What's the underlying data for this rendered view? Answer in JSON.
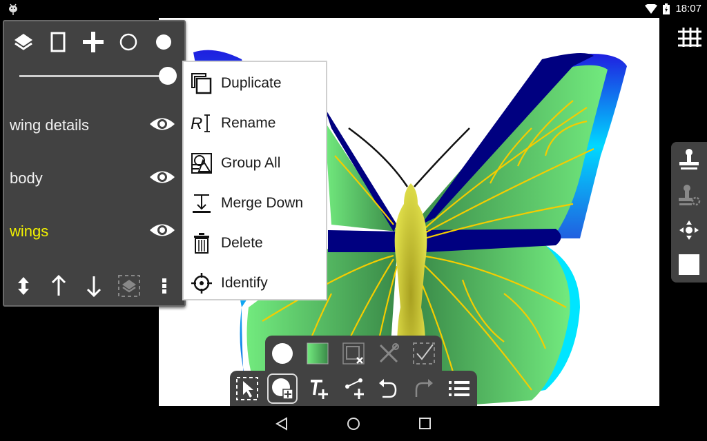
{
  "status_bar": {
    "time": "18:07",
    "icons": [
      "android-debug-icon",
      "wifi-icon",
      "battery-charging-icon"
    ]
  },
  "layers_panel": {
    "toolbar": [
      {
        "name": "layers-icon",
        "label": "Layers"
      },
      {
        "name": "page-icon",
        "label": "Page"
      },
      {
        "name": "add-layer-icon",
        "label": "Add"
      },
      {
        "name": "hollow-circle-icon",
        "label": "Outline"
      },
      {
        "name": "filled-circle-icon",
        "label": "Fill"
      }
    ],
    "opacity": 1.0,
    "layers": [
      {
        "name": "wing details",
        "visible": true,
        "active": false
      },
      {
        "name": "body",
        "visible": true,
        "active": false
      },
      {
        "name": "wings",
        "visible": true,
        "active": true
      }
    ],
    "bottom_actions": [
      "reorder-icon",
      "move-up-icon",
      "move-down-icon",
      "select-layer-icon",
      "more-options-icon"
    ],
    "active_color": "#f2f200"
  },
  "context_menu": {
    "items": [
      {
        "label": "Duplicate",
        "icon": "duplicate-icon"
      },
      {
        "label": "Rename",
        "icon": "rename-icon"
      },
      {
        "label": "Group All",
        "icon": "group-icon"
      },
      {
        "label": "Merge Down",
        "icon": "merge-down-icon"
      },
      {
        "label": "Delete",
        "icon": "delete-icon"
      },
      {
        "label": "Identify",
        "icon": "identify-icon"
      }
    ]
  },
  "right_toolbar": {
    "grid": "grid-icon",
    "tools": [
      "stamp-icon",
      "stamp-settings-icon",
      "move-icon",
      "color-swatch-icon"
    ]
  },
  "bottom_toolbar": {
    "top_row": [
      "fill-color-icon",
      "gradient-icon",
      "clear-selection-icon",
      "tools-icon",
      "confirm-selection-icon"
    ],
    "bottom_row": [
      "select-icon",
      "add-shape-icon",
      "add-text-icon",
      "add-path-icon",
      "undo-icon",
      "redo-icon",
      "list-icon"
    ],
    "selected": "add-shape-icon"
  },
  "nav_bar": [
    "back-icon",
    "home-icon",
    "recents-icon"
  ],
  "colors": {
    "panel": "#424242",
    "wing_dark": "#000080",
    "wing_green": "#6ee07a",
    "vein": "#f5cc00",
    "body": "#e0e040",
    "edge_cyan": "#00e5ff"
  }
}
